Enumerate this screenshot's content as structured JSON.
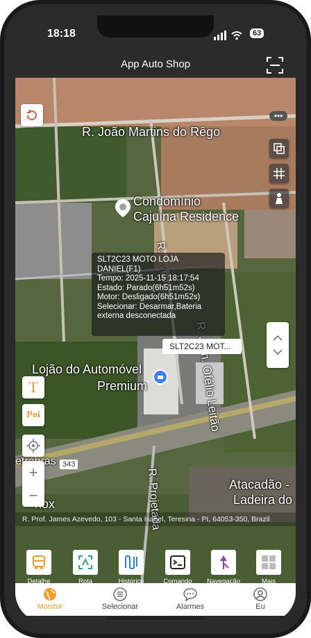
{
  "status_bar": {
    "time": "18:18",
    "battery": "63"
  },
  "header": {
    "title": "App Auto Shop"
  },
  "map": {
    "labels": {
      "street_top": "R. João Martins do Rêgo",
      "condo_line1": "Condomínio",
      "condo_line2": "Cajuína Residence",
      "store_line1": "Lojão do Automóvel",
      "store_line2": "Premium",
      "street_right": "R. Jorn. Ofélio Leitão",
      "street_mid": "R. ...vedo",
      "highway_left": "etrobras",
      "highway_number": "343",
      "atacadao_line1": "Atacadão -",
      "atacadao_line2": "Ladeira do",
      "street_projetada": "R. Projetada",
      "left_nox": "nox"
    },
    "controls": {
      "text_button": "T",
      "poi_button": "Poi",
      "zoom_in": "+",
      "zoom_out": "−"
    }
  },
  "popup": {
    "lines": [
      "SLT2C23 MOTO LOJA",
      "DANIEL(F1)",
      "Tempo: 2025-11-15 18:17:54",
      "Estado: Parado(6h51m52s)",
      "Motor: Desligado(6h51m52s)",
      "Selecionar: Desarmar,Bateria",
      "externa desconectada"
    ]
  },
  "vehicle_tag": "SLT2C23 MOT...",
  "address": "R. Prof. James Azevedo, 103 - Santa Isabel, Teresina - PI, 64053-350, Brazil",
  "toolbar": [
    {
      "label": "Detalhe",
      "icon": "bus-icon"
    },
    {
      "label": "Rota",
      "icon": "route-icon"
    },
    {
      "label": "Histórico",
      "icon": "history-icon"
    },
    {
      "label": "Comando",
      "icon": "terminal-icon"
    },
    {
      "label": "Navegação",
      "icon": "navigation-icon"
    },
    {
      "label": "Mais",
      "icon": "grid-icon"
    }
  ],
  "bottom_nav": [
    {
      "label": "Monitor",
      "active": true
    },
    {
      "label": "Selecionar",
      "active": false
    },
    {
      "label": "Alarmes",
      "active": false
    },
    {
      "label": "Eu",
      "active": false
    }
  ],
  "colors": {
    "accent": "#f39c2b",
    "nav_active": "#f39c2b",
    "nav_inactive": "#444444"
  }
}
